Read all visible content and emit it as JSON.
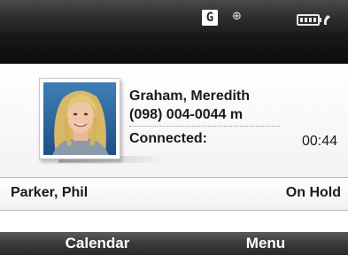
{
  "status_bar": {
    "network_icon_label": "G",
    "roaming_icon": "roaming-icon",
    "battery_icon": "battery-phone-icon"
  },
  "active_call": {
    "contact_name": "Graham, Meredith",
    "phone_number": "(098) 004-0044 m",
    "status": "Connected:",
    "timer": "00:44",
    "photo_icon": "contact-photo"
  },
  "held_call": {
    "contact_name": "Parker, Phil",
    "status": "On Hold"
  },
  "softkeys": {
    "left_label": "Calendar",
    "right_label": "Menu"
  },
  "colors": {
    "bar_dark": "#2e2e2e",
    "text": "#1b1b1b",
    "softkey_text": "#ffffff"
  }
}
